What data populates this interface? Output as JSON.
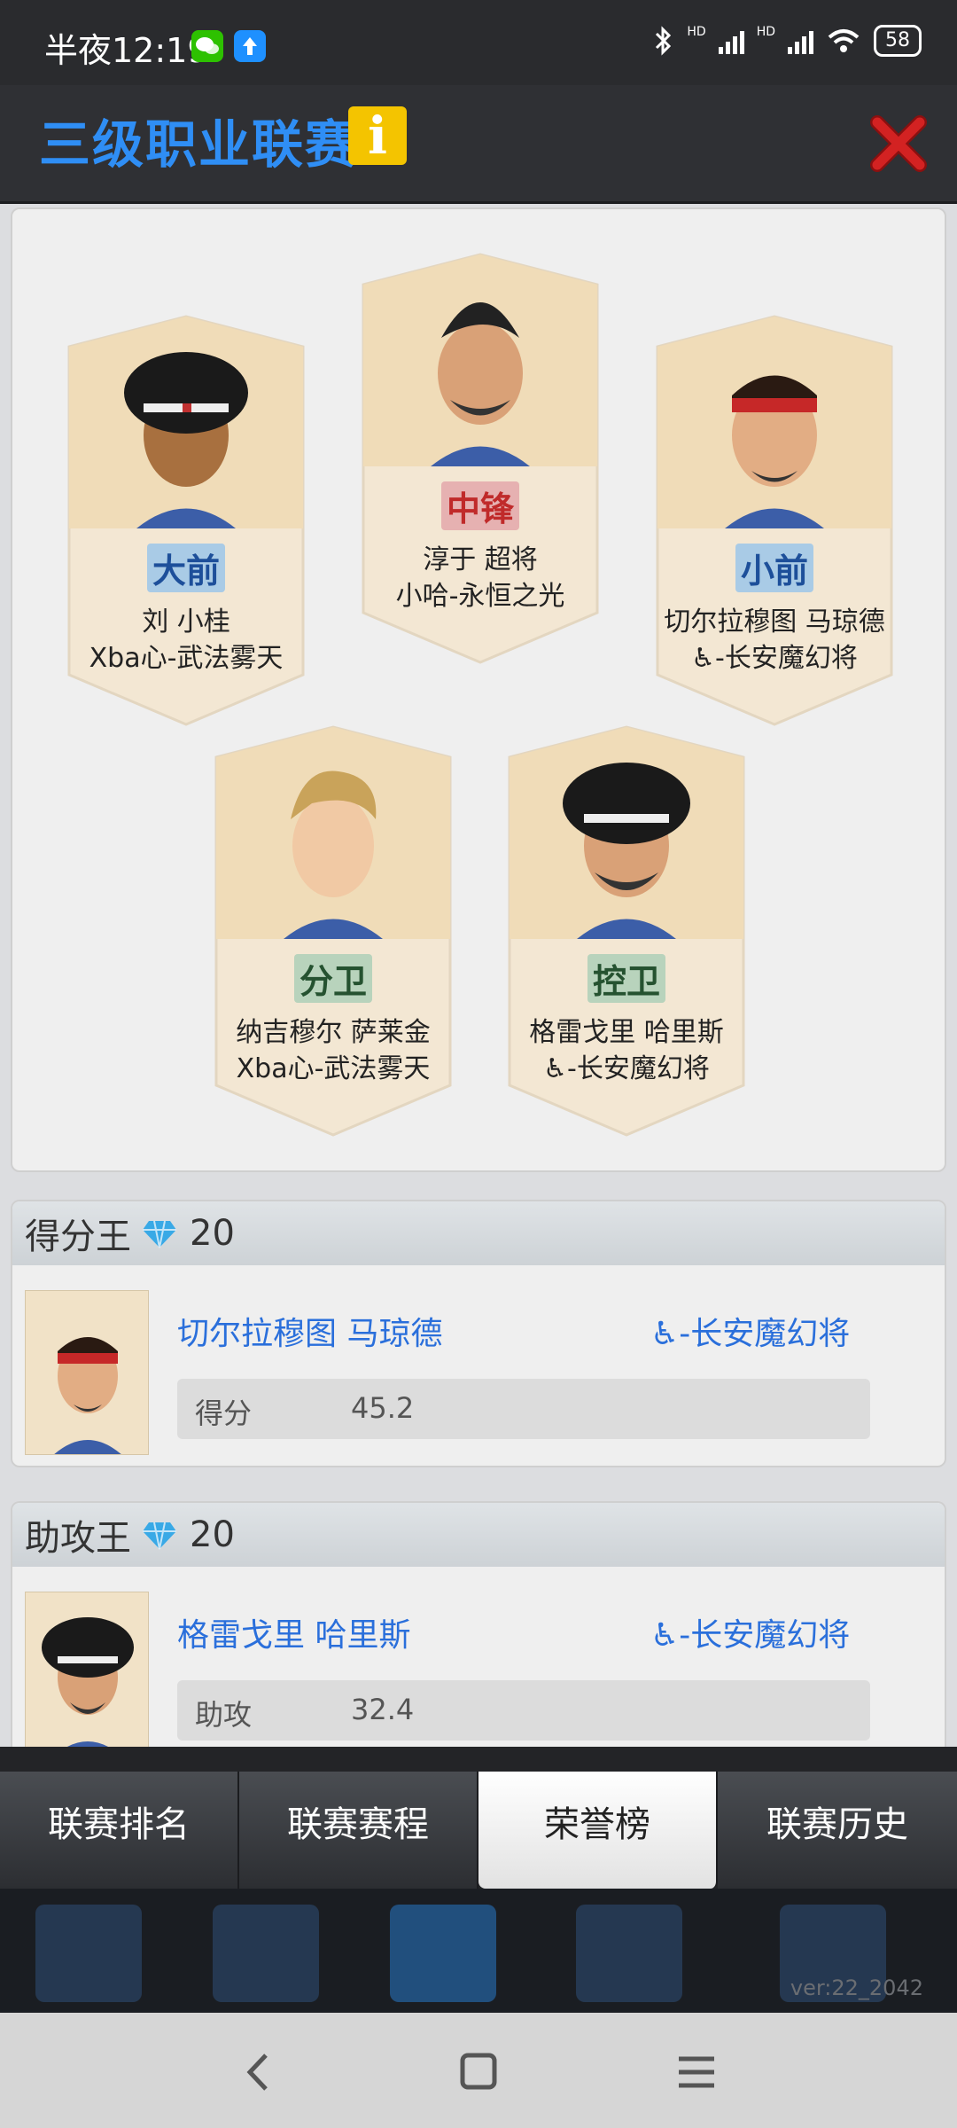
{
  "status": {
    "time": "半夜12:19",
    "battery": "58",
    "hd1": "HD",
    "hd2": "HD"
  },
  "header": {
    "title": "三级职业联赛",
    "info_glyph": "i"
  },
  "lineup": [
    {
      "pos": "大前",
      "pos_type": "f",
      "player": "刘 小桂",
      "team": "Xba心-武法雾天",
      "blue": false
    },
    {
      "pos": "中锋",
      "pos_type": "c",
      "player": "淳于 超将",
      "team": "小哈-永恒之光",
      "blue": false
    },
    {
      "pos": "小前",
      "pos_type": "f",
      "player": "切尔拉穆图 马琼德",
      "team": "♿-长安魔幻将",
      "blue": true
    },
    {
      "pos": "分卫",
      "pos_type": "g",
      "player": "纳吉穆尔 萨莱金",
      "team": "Xba心-武法雾天",
      "blue": false
    },
    {
      "pos": "控卫",
      "pos_type": "g",
      "player": "格雷戈里 哈里斯",
      "team": "♿-长安魔幻将",
      "blue": true
    }
  ],
  "awards": [
    {
      "title": "得分王",
      "reward": "20",
      "player": "切尔拉穆图 马琼德",
      "team": "♿-长安魔幻将",
      "stat_label": "得分",
      "stat_value": "45.2"
    },
    {
      "title": "助攻王",
      "reward": "20",
      "player": "格雷戈里 哈里斯",
      "team": "♿-长安魔幻将",
      "stat_label": "助攻",
      "stat_value": "32.4"
    }
  ],
  "tabs": [
    {
      "label": "联赛排名",
      "active": false
    },
    {
      "label": "联赛赛程",
      "active": false
    },
    {
      "label": "荣誉榜",
      "active": true
    },
    {
      "label": "联赛历史",
      "active": false
    }
  ],
  "version": "ver:22_2042",
  "colors": {
    "title_blue": "#2f8ef5",
    "link_blue": "#2a6fdb",
    "close_red": "#d32222",
    "info_yellow": "#f4c400",
    "card_bg": "#f1e2c7"
  }
}
